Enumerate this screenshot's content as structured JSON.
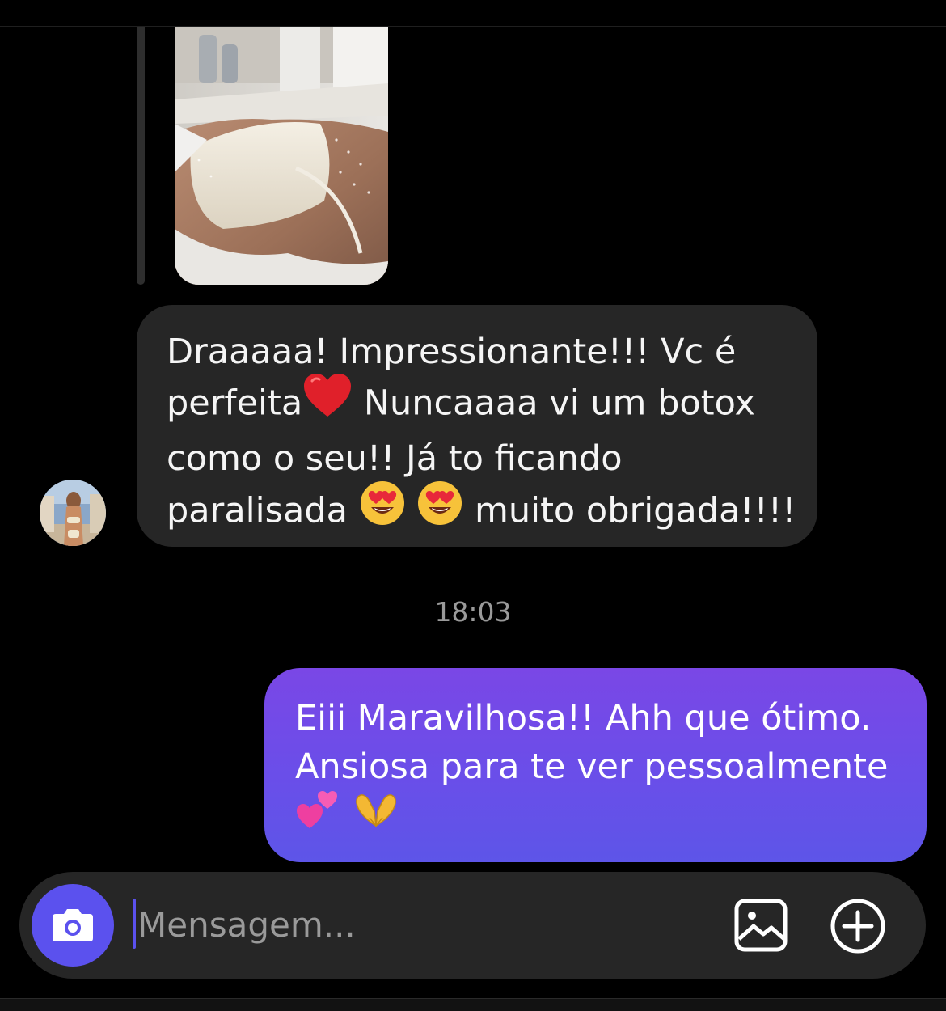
{
  "thread": {
    "incoming_message": {
      "lines": [
        "Draaaaa! Impressionante!!! Vc é",
        "perfeita",
        "Nuncaaaa vi um botox",
        "como o seu!! Já to ficando",
        "paralisada",
        "muito obrigada!!!!"
      ],
      "emojis": [
        "red-heart",
        "heart-eyes",
        "heart-eyes"
      ]
    },
    "timestamp": "18:03",
    "outgoing_message": {
      "lines": [
        "Eiii Maravilhosa!! Ahh que ótimo.",
        "Ansiosa para te ver pessoalmente"
      ],
      "emojis": [
        "two-hearts",
        "heart-hands"
      ]
    }
  },
  "composer": {
    "placeholder": "Mensagem..."
  },
  "colors": {
    "background": "#000000",
    "incoming_bubble": "#262626",
    "outgoing_bubble_top": "#7a47e6",
    "outgoing_bubble_bottom": "#5d55e8",
    "accent": "#5b51ee",
    "timestamp_text": "#9a9a9a"
  },
  "icons": {
    "composer_left": "camera-icon",
    "composer_right": [
      "gallery-icon",
      "add-circle-icon"
    ]
  }
}
